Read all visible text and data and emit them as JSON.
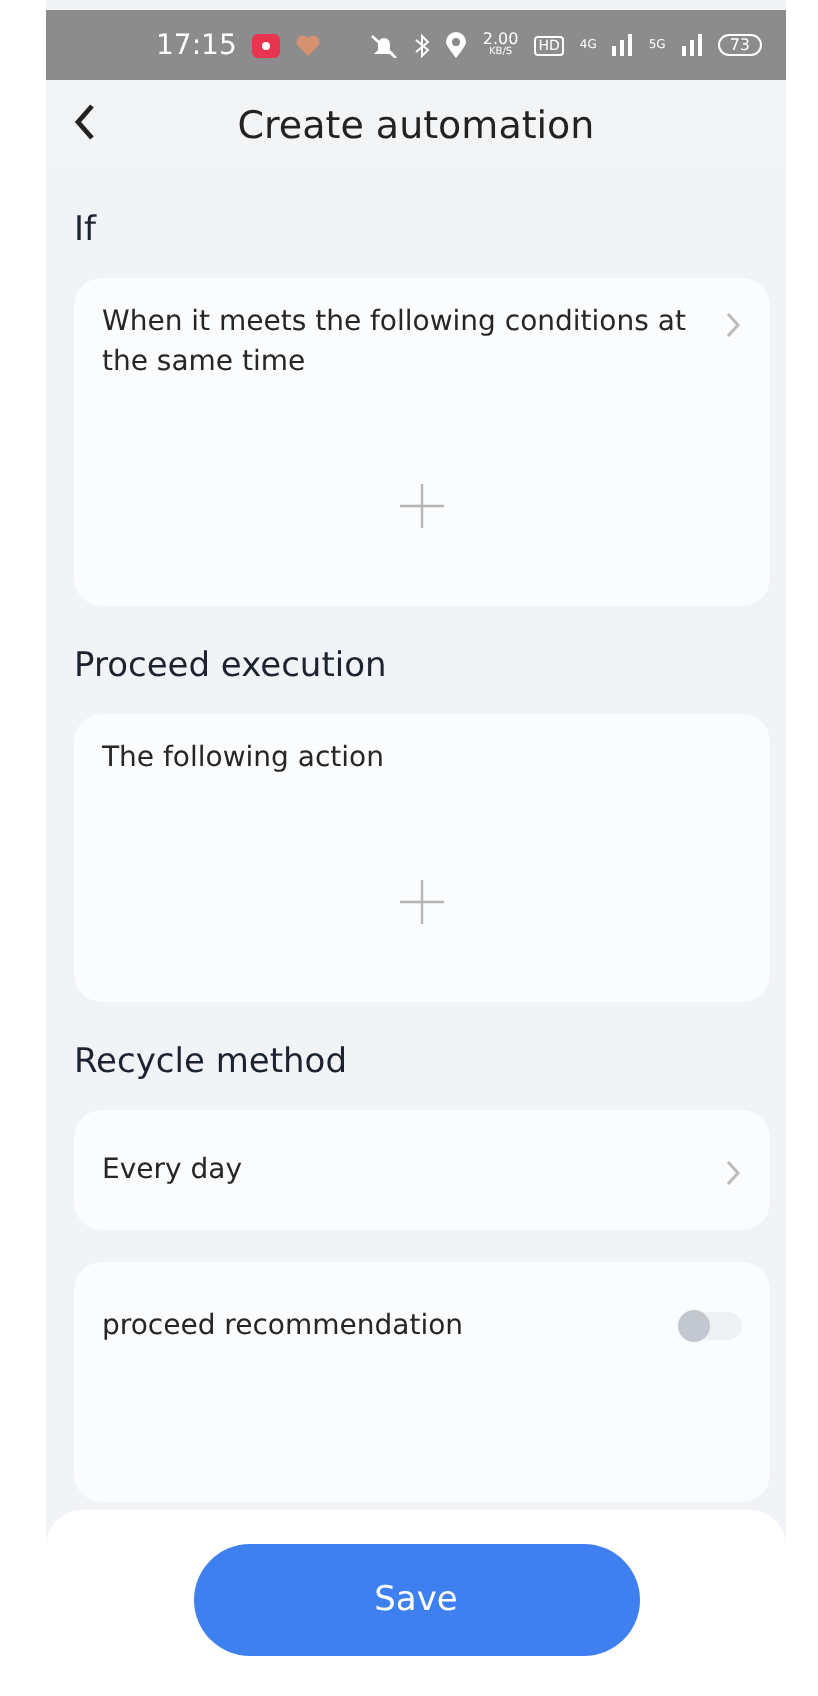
{
  "status_bar": {
    "time": "17:15",
    "speed": "2.00",
    "speed_unit": "KB/S",
    "hd": "HD",
    "network_1": "4G",
    "network_2": "5G",
    "battery": "73"
  },
  "header": {
    "title": "Create automation"
  },
  "sections": [
    {
      "title": "If",
      "card": {
        "kind": "add",
        "text": "When it meets the following conditions at the same time",
        "chevron": true
      }
    },
    {
      "title": "Proceed execution",
      "card": {
        "kind": "add",
        "text": "The following action",
        "chevron": false
      }
    },
    {
      "title": "Recycle method",
      "card": {
        "kind": "link",
        "text": "Every day",
        "chevron": true
      }
    }
  ],
  "recommendation": {
    "label": "proceed recommendation",
    "on": false
  },
  "save_button": {
    "label": "Save"
  }
}
